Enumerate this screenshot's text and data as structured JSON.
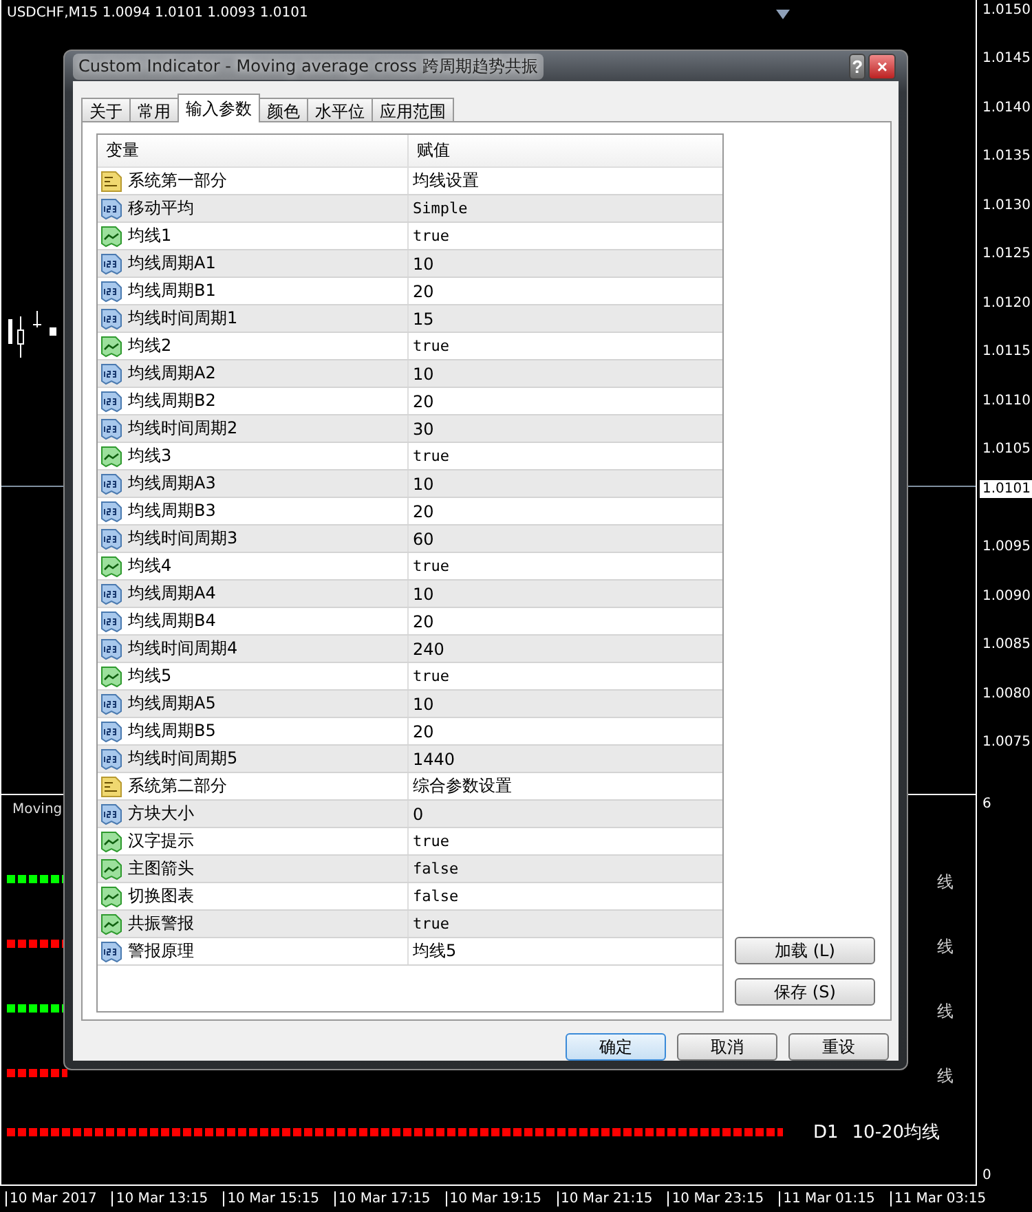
{
  "chart": {
    "symbol": "USDCHF,M15  1.0094 1.0101 1.0093 1.0101",
    "price_ticks": [
      "1.0150",
      "1.0145",
      "1.0140",
      "1.0135",
      "1.0130",
      "1.0125",
      "1.0120",
      "1.0115",
      "1.0110",
      "1.0105",
      "1.0095",
      "1.0090",
      "1.0085",
      "1.0080",
      "1.0075"
    ],
    "current_price": "1.0101",
    "sub_window": {
      "label": "Moving",
      "max": "6",
      "min": "0",
      "signal_rows": [
        {
          "color": "#00ff00",
          "side_text": "线"
        },
        {
          "color": "#ff0000",
          "side_text": "线"
        },
        {
          "color": "#00ff00",
          "side_text": "线"
        },
        {
          "color": "#ff0000",
          "side_text": "线"
        }
      ],
      "bottom_row": {
        "color": "#ff0000",
        "timeframe": "D1",
        "text": "10-20均线"
      }
    },
    "time_ticks": [
      "10 Mar 2017",
      "10 Mar 13:15",
      "10 Mar 15:15",
      "10 Mar 17:15",
      "10 Mar 19:15",
      "10 Mar 21:15",
      "10 Mar 23:15",
      "11 Mar 01:15",
      "11 Mar 03:15"
    ]
  },
  "dialog": {
    "title": "Custom Indicator - Moving average cross 跨周期趋势共振",
    "help": "?",
    "close": "×",
    "tabs": [
      {
        "label": "关于",
        "selected": false
      },
      {
        "label": "常用",
        "selected": false
      },
      {
        "label": "输入参数",
        "selected": true
      },
      {
        "label": "颜色",
        "selected": false
      },
      {
        "label": "水平位",
        "selected": false
      },
      {
        "label": "应用范围",
        "selected": false
      }
    ],
    "table": {
      "columns": [
        "变量",
        "赋值"
      ],
      "rows": [
        {
          "kind": "string",
          "name": "系统第一部分",
          "value": "均线设置"
        },
        {
          "kind": "enum",
          "name": "移动平均",
          "value": "Simple"
        },
        {
          "kind": "bool",
          "name": "均线1",
          "value": "true"
        },
        {
          "kind": "int",
          "name": "均线周期A1",
          "value": "10"
        },
        {
          "kind": "int",
          "name": "均线周期B1",
          "value": "20"
        },
        {
          "kind": "int",
          "name": "均线时间周期1",
          "value": "15"
        },
        {
          "kind": "bool",
          "name": "均线2",
          "value": "true"
        },
        {
          "kind": "int",
          "name": "均线周期A2",
          "value": "10"
        },
        {
          "kind": "int",
          "name": "均线周期B2",
          "value": "20"
        },
        {
          "kind": "int",
          "name": "均线时间周期2",
          "value": "30"
        },
        {
          "kind": "bool",
          "name": "均线3",
          "value": "true"
        },
        {
          "kind": "int",
          "name": "均线周期A3",
          "value": "10"
        },
        {
          "kind": "int",
          "name": "均线周期B3",
          "value": "20"
        },
        {
          "kind": "int",
          "name": "均线时间周期3",
          "value": "60"
        },
        {
          "kind": "bool",
          "name": "均线4",
          "value": "true"
        },
        {
          "kind": "int",
          "name": "均线周期A4",
          "value": "10"
        },
        {
          "kind": "int",
          "name": "均线周期B4",
          "value": "20"
        },
        {
          "kind": "int",
          "name": "均线时间周期4",
          "value": "240"
        },
        {
          "kind": "bool",
          "name": "均线5",
          "value": "true"
        },
        {
          "kind": "int",
          "name": "均线周期A5",
          "value": "10"
        },
        {
          "kind": "int",
          "name": "均线周期B5",
          "value": "20"
        },
        {
          "kind": "int",
          "name": "均线时间周期5",
          "value": "1440"
        },
        {
          "kind": "string",
          "name": "系统第二部分",
          "value": "综合参数设置"
        },
        {
          "kind": "int",
          "name": "方块大小",
          "value": "0"
        },
        {
          "kind": "bool",
          "name": "汉字提示",
          "value": "true"
        },
        {
          "kind": "bool",
          "name": "主图箭头",
          "value": "false"
        },
        {
          "kind": "bool",
          "name": "切换图表",
          "value": "false"
        },
        {
          "kind": "bool",
          "name": "共振警报",
          "value": "true"
        },
        {
          "kind": "int",
          "name": "警报原理",
          "value": "均线5"
        }
      ]
    },
    "side_buttons": [
      "加载 (L)",
      "保存 (S)"
    ],
    "buttons": [
      "确定",
      "取消",
      "重设"
    ]
  }
}
